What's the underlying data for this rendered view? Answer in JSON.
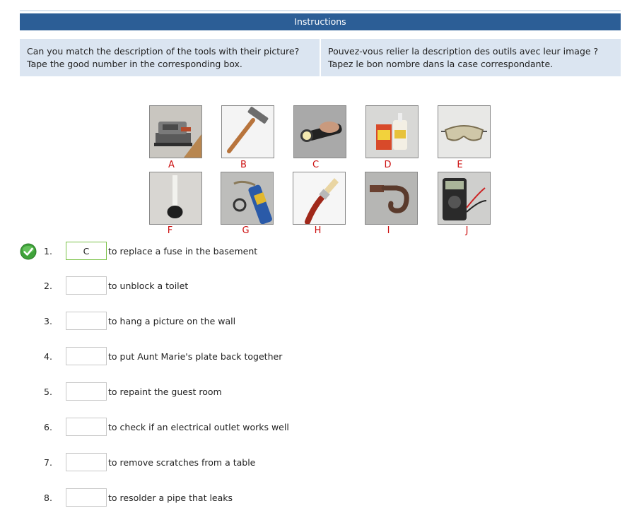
{
  "header": {
    "title": "Instructions"
  },
  "instructions": {
    "en_line1": "Can you match the description of the tools with their picture?",
    "en_line2": "Tape the good number in the corresponding box.",
    "fr_line1": "Pouvez-vous relier la description des outils avec leur image ?",
    "fr_line2": "Tapez le bon nombre dans la case correspondante."
  },
  "images": [
    {
      "label": "A",
      "icon": "sander-icon"
    },
    {
      "label": "B",
      "icon": "hammer-icon"
    },
    {
      "label": "C",
      "icon": "flashlight-icon"
    },
    {
      "label": "D",
      "icon": "glue-bottles-icon"
    },
    {
      "label": "E",
      "icon": "safety-goggles-icon"
    },
    {
      "label": "F",
      "icon": "plunger-icon"
    },
    {
      "label": "G",
      "icon": "blowtorch-icon"
    },
    {
      "label": "H",
      "icon": "paintbrush-icon"
    },
    {
      "label": "I",
      "icon": "hook-icon"
    },
    {
      "label": "J",
      "icon": "multimeter-icon"
    }
  ],
  "questions": [
    {
      "num": "1.",
      "answer": "C",
      "text": "to replace a fuse in the basement",
      "status": "correct"
    },
    {
      "num": "2.",
      "answer": "",
      "text": "to unblock a toilet",
      "status": ""
    },
    {
      "num": "3.",
      "answer": "",
      "text": "to hang a picture on the wall",
      "status": ""
    },
    {
      "num": "4.",
      "answer": "",
      "text": "to put Aunt Marie's plate back together",
      "status": ""
    },
    {
      "num": "5.",
      "answer": "",
      "text": "to repaint the guest room",
      "status": ""
    },
    {
      "num": "6.",
      "answer": "",
      "text": "to check if an electrical outlet works well",
      "status": ""
    },
    {
      "num": "7.",
      "answer": "",
      "text": "to remove scratches from a table",
      "status": ""
    },
    {
      "num": "8.",
      "answer": "",
      "text": "to resolder a pipe that leaks",
      "status": ""
    }
  ],
  "colors": {
    "header_bg": "#2c5e96",
    "instr_bg": "#dbe5f1",
    "label_red": "#cc1111",
    "correct_green": "#7cc24a"
  }
}
